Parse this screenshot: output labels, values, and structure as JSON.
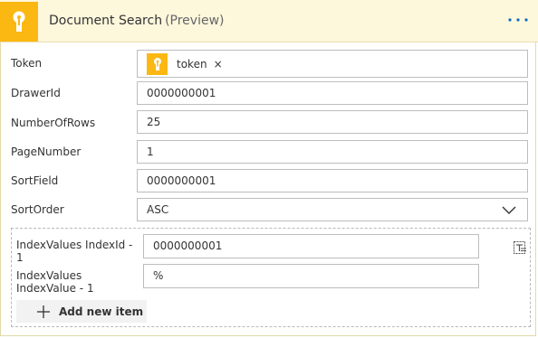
{
  "header": {
    "title": "Document Search",
    "subtitle": "(Preview)",
    "icon": "keyhole-icon",
    "accent": "#fbb812"
  },
  "fields": {
    "token": {
      "label": "Token",
      "chip": "token"
    },
    "drawer_id": {
      "label": "DrawerId",
      "value": "0000000001"
    },
    "number_of_rows": {
      "label": "NumberOfRows",
      "value": "25"
    },
    "page_number": {
      "label": "PageNumber",
      "value": "1"
    },
    "sort_field": {
      "label": "SortField",
      "value": "0000000001"
    },
    "sort_order": {
      "label": "SortOrder",
      "value": "ASC"
    }
  },
  "index_values": {
    "items": [
      {
        "id_label_line1": "IndexValues IndexId -",
        "id_label_line2": "1",
        "id_value": "0000000001",
        "value_label_line1": "IndexValues",
        "value_label_line2": "IndexValue - 1",
        "value": "%"
      }
    ],
    "add_label": "Add new item"
  },
  "colors": {
    "header_bg": "#fdf7dc",
    "link_blue": "#0f6cbd"
  }
}
